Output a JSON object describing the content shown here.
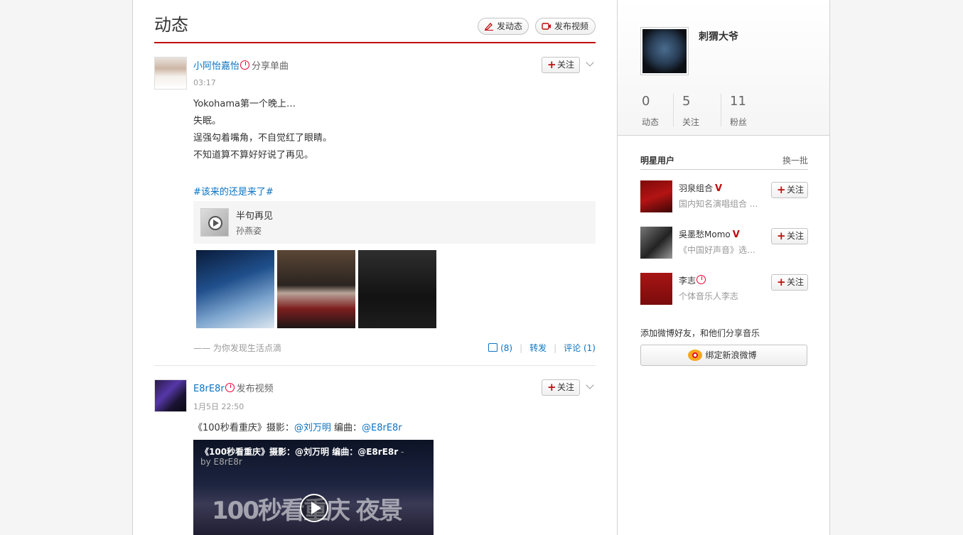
{
  "header": {
    "title": "动态",
    "post_label": "发动态",
    "video_label": "发布视频"
  },
  "posts": [
    {
      "user": "小阿怡嘉怡",
      "action": "分享单曲",
      "time": "03:17",
      "follow": "关注",
      "lines": [
        "Yokohama第一个晚上…",
        "失眠。",
        "逞强勾着嘴角，不自觉红了眼睛。",
        "不知道算不算好好说了再见。"
      ],
      "tag": "#该来的还是来了#",
      "song": {
        "name": "半句再见",
        "artist": "孙燕姿"
      },
      "source": "—— 为你发现生活点滴",
      "likes": "(8)",
      "forward": "转发",
      "comment": "评论 (1)"
    },
    {
      "user": "E8rE8r",
      "action": "发布视频",
      "time": "1月5日 22:50",
      "follow": "关注",
      "text_prefix": "《100秒看重庆》摄影：",
      "mention1": "@刘万明",
      "text_mid": " 编曲：",
      "mention2": "@E8rE8r",
      "video_title": "《100秒看重庆》摄影：@刘万明 编曲：@E8rE8r",
      "video_by": " - by E8rE8r",
      "video_overlay": "100秒看重庆 夜景"
    }
  ],
  "profile": {
    "name": "刺猬大爷",
    "stats": [
      {
        "num": "0",
        "label": "动态"
      },
      {
        "num": "5",
        "label": "关注"
      },
      {
        "num": "11",
        "label": "粉丝"
      }
    ]
  },
  "stars": {
    "title": "明星用户",
    "refresh": "换一批",
    "items": [
      {
        "name": "羽泉组合",
        "desc": "国内知名演唱组合 ...",
        "follow": "关注",
        "badge": "V"
      },
      {
        "name": "吳墨愁Momo",
        "desc": "《中国好声音》选手...",
        "follow": "关注",
        "badge": "V"
      },
      {
        "name": "李志",
        "desc": "个体音乐人李志",
        "follow": "关注",
        "badge": ""
      }
    ]
  },
  "bind": {
    "tip": "添加微博好友，和他们分享音乐",
    "button": "绑定新浪微博"
  }
}
